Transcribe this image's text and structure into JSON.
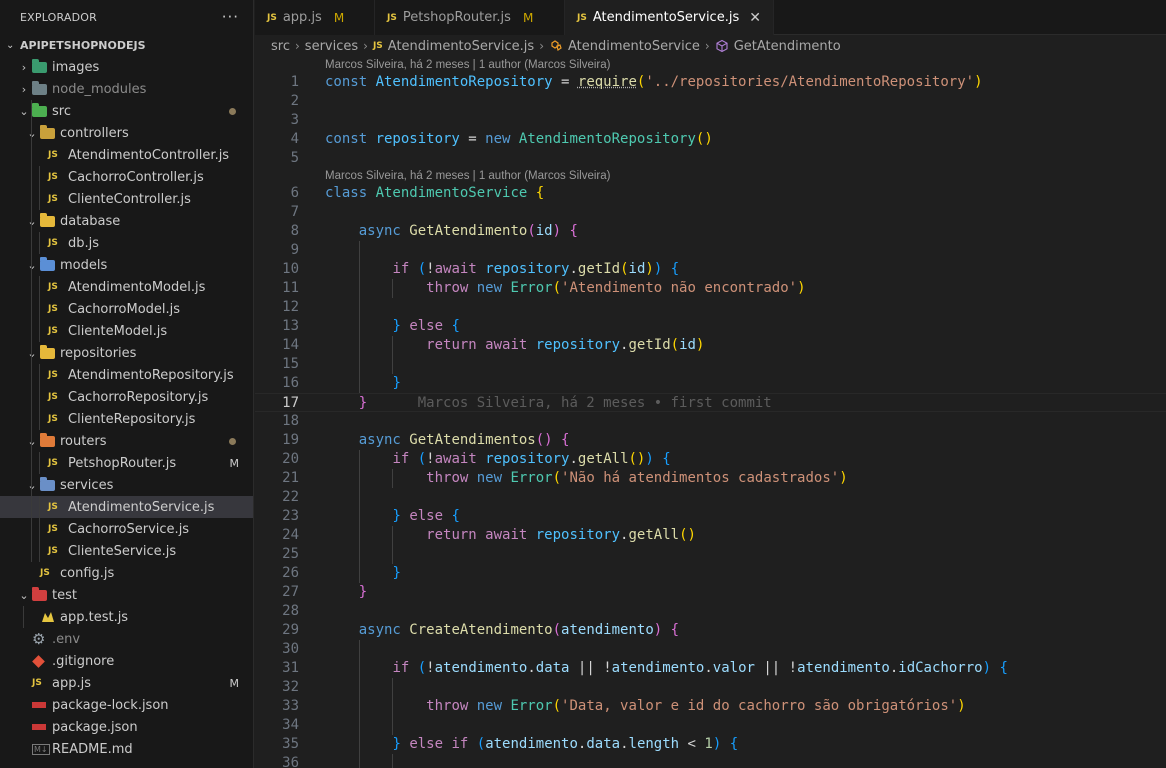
{
  "sidebar": {
    "title": "EXPLORADOR",
    "more": "···",
    "project": "APIPETSHOPNODEJS",
    "items": [
      {
        "label": "images",
        "depth": 1,
        "type": "folder",
        "chev": "›",
        "color": "#3a9b6f"
      },
      {
        "label": "node_modules",
        "depth": 1,
        "type": "folder",
        "chev": "›",
        "color": "#6d8086",
        "dimmed": true
      },
      {
        "label": "src",
        "depth": 1,
        "type": "folder",
        "chev": "⌄",
        "color": "#4caf50",
        "dot": true
      },
      {
        "label": "controllers",
        "depth": 2,
        "type": "folder",
        "chev": "⌄",
        "color": "#c9a13b"
      },
      {
        "label": "AtendimentoController.js",
        "depth": 3,
        "type": "js"
      },
      {
        "label": "CachorroController.js",
        "depth": 3,
        "type": "js"
      },
      {
        "label": "ClienteController.js",
        "depth": 3,
        "type": "js"
      },
      {
        "label": "database",
        "depth": 2,
        "type": "folder",
        "chev": "⌄",
        "color": "#e5b83a"
      },
      {
        "label": "db.js",
        "depth": 3,
        "type": "js"
      },
      {
        "label": "models",
        "depth": 2,
        "type": "folder",
        "chev": "⌄",
        "color": "#5b8fd6"
      },
      {
        "label": "AtendimentoModel.js",
        "depth": 3,
        "type": "js"
      },
      {
        "label": "CachorroModel.js",
        "depth": 3,
        "type": "js"
      },
      {
        "label": "ClienteModel.js",
        "depth": 3,
        "type": "js"
      },
      {
        "label": "repositories",
        "depth": 2,
        "type": "folder",
        "chev": "⌄",
        "color": "#e5b83a"
      },
      {
        "label": "AtendimentoRepository.js",
        "depth": 3,
        "type": "js"
      },
      {
        "label": "CachorroRepository.js",
        "depth": 3,
        "type": "js"
      },
      {
        "label": "ClienteRepository.js",
        "depth": 3,
        "type": "js"
      },
      {
        "label": "routers",
        "depth": 2,
        "type": "folder",
        "chev": "⌄",
        "color": "#e07b39",
        "dot": true
      },
      {
        "label": "PetshopRouter.js",
        "depth": 3,
        "type": "js",
        "status": "M"
      },
      {
        "label": "services",
        "depth": 2,
        "type": "folder",
        "chev": "⌄",
        "color": "#6a8fc7"
      },
      {
        "label": "AtendimentoService.js",
        "depth": 3,
        "type": "js",
        "selected": true
      },
      {
        "label": "CachorroService.js",
        "depth": 3,
        "type": "js"
      },
      {
        "label": "ClienteService.js",
        "depth": 3,
        "type": "js"
      },
      {
        "label": "config.js",
        "depth": 2,
        "type": "js"
      },
      {
        "label": "test",
        "depth": 1,
        "type": "folder",
        "chev": "⌄",
        "color": "#d13f3f"
      },
      {
        "label": "app.test.js",
        "depth": 2,
        "type": "test"
      },
      {
        "label": ".env",
        "depth": 1,
        "type": "env",
        "dimmed": true
      },
      {
        "label": ".gitignore",
        "depth": 1,
        "type": "git"
      },
      {
        "label": "app.js",
        "depth": 1,
        "type": "js",
        "status": "M"
      },
      {
        "label": "package-lock.json",
        "depth": 1,
        "type": "npm"
      },
      {
        "label": "package.json",
        "depth": 1,
        "type": "npm"
      },
      {
        "label": "README.md",
        "depth": 1,
        "type": "md"
      }
    ]
  },
  "tabs": [
    {
      "label": "app.js",
      "status": "M",
      "active": false
    },
    {
      "label": "PetshopRouter.js",
      "status": "M",
      "active": false
    },
    {
      "label": "AtendimentoService.js",
      "status": "",
      "active": true,
      "close": "✕"
    }
  ],
  "breadcrumb": [
    "src",
    "services",
    "AtendimentoService.js",
    "AtendimentoService",
    "GetAtendimento"
  ],
  "editor": {
    "codelens": "Marcos Silveira, há 2 meses | 1 author (Marcos Silveira)",
    "blame": "Marcos Silveira, há 2 meses • first commit",
    "current_line": 17,
    "lines": [
      {
        "n": 1,
        "lens": true,
        "tokens": [
          [
            "kw",
            "const "
          ],
          [
            "var",
            "AtendimentoRepository"
          ],
          [
            "op",
            " = "
          ],
          [
            "req",
            "require"
          ],
          [
            "b1",
            "("
          ],
          [
            "str",
            "'../repositories/AtendimentoRepository'"
          ],
          [
            "b1",
            ")"
          ]
        ]
      },
      {
        "n": 2,
        "tokens": []
      },
      {
        "n": 3,
        "tokens": []
      },
      {
        "n": 4,
        "tokens": [
          [
            "kw",
            "const "
          ],
          [
            "var",
            "repository"
          ],
          [
            "op",
            " = "
          ],
          [
            "kw",
            "new "
          ],
          [
            "cls",
            "AtendimentoRepository"
          ],
          [
            "b1",
            "()"
          ]
        ]
      },
      {
        "n": 5,
        "tokens": []
      },
      {
        "n": 6,
        "lens": true,
        "tokens": [
          [
            "kw",
            "class "
          ],
          [
            "cls",
            "AtendimentoService"
          ],
          [
            "op",
            " "
          ],
          [
            "b1",
            "{"
          ]
        ]
      },
      {
        "n": 7,
        "tokens": []
      },
      {
        "n": 8,
        "tokens": [
          [
            "op",
            "    "
          ],
          [
            "kw",
            "async "
          ],
          [
            "fn",
            "GetAtendimento"
          ],
          [
            "b2",
            "("
          ],
          [
            "prop",
            "id"
          ],
          [
            "b2",
            ")"
          ],
          [
            "op",
            " "
          ],
          [
            "b2",
            "{"
          ]
        ]
      },
      {
        "n": 9,
        "tokens": []
      },
      {
        "n": 10,
        "tokens": [
          [
            "op",
            "        "
          ],
          [
            "ctl",
            "if "
          ],
          [
            "b3",
            "("
          ],
          [
            "op",
            "!"
          ],
          [
            "ctl",
            "await "
          ],
          [
            "var",
            "repository"
          ],
          [
            "op",
            "."
          ],
          [
            "fn",
            "getId"
          ],
          [
            "b1",
            "("
          ],
          [
            "prop",
            "id"
          ],
          [
            "b1",
            ")"
          ],
          [
            "b3",
            ")"
          ],
          [
            "op",
            " "
          ],
          [
            "b3",
            "{"
          ]
        ]
      },
      {
        "n": 11,
        "tokens": [
          [
            "op",
            "            "
          ],
          [
            "ctl",
            "throw "
          ],
          [
            "kw",
            "new "
          ],
          [
            "cls",
            "Error"
          ],
          [
            "b1",
            "("
          ],
          [
            "str",
            "'Atendimento não encontrado'"
          ],
          [
            "b1",
            ")"
          ]
        ]
      },
      {
        "n": 12,
        "tokens": []
      },
      {
        "n": 13,
        "tokens": [
          [
            "op",
            "        "
          ],
          [
            "b3",
            "}"
          ],
          [
            "op",
            " "
          ],
          [
            "ctl",
            "else "
          ],
          [
            "b3",
            "{"
          ]
        ]
      },
      {
        "n": 14,
        "tokens": [
          [
            "op",
            "            "
          ],
          [
            "ctl",
            "return "
          ],
          [
            "ctl",
            "await "
          ],
          [
            "var",
            "repository"
          ],
          [
            "op",
            "."
          ],
          [
            "fn",
            "getId"
          ],
          [
            "b1",
            "("
          ],
          [
            "prop",
            "id"
          ],
          [
            "b1",
            ")"
          ]
        ]
      },
      {
        "n": 15,
        "tokens": []
      },
      {
        "n": 16,
        "tokens": [
          [
            "op",
            "        "
          ],
          [
            "b3",
            "}"
          ]
        ]
      },
      {
        "n": 17,
        "tokens": [
          [
            "op",
            "    "
          ],
          [
            "b2",
            "}"
          ]
        ],
        "blame": true
      },
      {
        "n": 18,
        "tokens": []
      },
      {
        "n": 19,
        "tokens": [
          [
            "op",
            "    "
          ],
          [
            "kw",
            "async "
          ],
          [
            "fn",
            "GetAtendimentos"
          ],
          [
            "b2",
            "()"
          ],
          [
            "op",
            " "
          ],
          [
            "b2",
            "{"
          ]
        ]
      },
      {
        "n": 20,
        "tokens": [
          [
            "op",
            "        "
          ],
          [
            "ctl",
            "if "
          ],
          [
            "b3",
            "("
          ],
          [
            "op",
            "!"
          ],
          [
            "ctl",
            "await "
          ],
          [
            "var",
            "repository"
          ],
          [
            "op",
            "."
          ],
          [
            "fn",
            "getAll"
          ],
          [
            "b1",
            "()"
          ],
          [
            "b3",
            ")"
          ],
          [
            "op",
            " "
          ],
          [
            "b3",
            "{"
          ]
        ]
      },
      {
        "n": 21,
        "tokens": [
          [
            "op",
            "            "
          ],
          [
            "ctl",
            "throw "
          ],
          [
            "kw",
            "new "
          ],
          [
            "cls",
            "Error"
          ],
          [
            "b1",
            "("
          ],
          [
            "str",
            "'Não há atendimentos cadastrados'"
          ],
          [
            "b1",
            ")"
          ]
        ]
      },
      {
        "n": 22,
        "tokens": []
      },
      {
        "n": 23,
        "tokens": [
          [
            "op",
            "        "
          ],
          [
            "b3",
            "}"
          ],
          [
            "op",
            " "
          ],
          [
            "ctl",
            "else "
          ],
          [
            "b3",
            "{"
          ]
        ]
      },
      {
        "n": 24,
        "tokens": [
          [
            "op",
            "            "
          ],
          [
            "ctl",
            "return "
          ],
          [
            "ctl",
            "await "
          ],
          [
            "var",
            "repository"
          ],
          [
            "op",
            "."
          ],
          [
            "fn",
            "getAll"
          ],
          [
            "b1",
            "()"
          ]
        ]
      },
      {
        "n": 25,
        "tokens": []
      },
      {
        "n": 26,
        "tokens": [
          [
            "op",
            "        "
          ],
          [
            "b3",
            "}"
          ]
        ]
      },
      {
        "n": 27,
        "tokens": [
          [
            "op",
            "    "
          ],
          [
            "b2",
            "}"
          ]
        ]
      },
      {
        "n": 28,
        "tokens": []
      },
      {
        "n": 29,
        "tokens": [
          [
            "op",
            "    "
          ],
          [
            "kw",
            "async "
          ],
          [
            "fn",
            "CreateAtendimento"
          ],
          [
            "b2",
            "("
          ],
          [
            "prop",
            "atendimento"
          ],
          [
            "b2",
            ")"
          ],
          [
            "op",
            " "
          ],
          [
            "b2",
            "{"
          ]
        ]
      },
      {
        "n": 30,
        "tokens": []
      },
      {
        "n": 31,
        "tokens": [
          [
            "op",
            "        "
          ],
          [
            "ctl",
            "if "
          ],
          [
            "b3",
            "("
          ],
          [
            "op",
            "!"
          ],
          [
            "prop",
            "atendimento"
          ],
          [
            "op",
            "."
          ],
          [
            "prop",
            "data"
          ],
          [
            "op",
            " || !"
          ],
          [
            "prop",
            "atendimento"
          ],
          [
            "op",
            "."
          ],
          [
            "prop",
            "valor"
          ],
          [
            "op",
            " || !"
          ],
          [
            "prop",
            "atendimento"
          ],
          [
            "op",
            "."
          ],
          [
            "prop",
            "idCachorro"
          ],
          [
            "b3",
            ")"
          ],
          [
            "op",
            " "
          ],
          [
            "b3",
            "{"
          ]
        ]
      },
      {
        "n": 32,
        "tokens": []
      },
      {
        "n": 33,
        "tokens": [
          [
            "op",
            "            "
          ],
          [
            "ctl",
            "throw "
          ],
          [
            "kw",
            "new "
          ],
          [
            "cls",
            "Error"
          ],
          [
            "b1",
            "("
          ],
          [
            "str",
            "'Data, valor e id do cachorro são obrigatórios'"
          ],
          [
            "b1",
            ")"
          ]
        ]
      },
      {
        "n": 34,
        "tokens": []
      },
      {
        "n": 35,
        "tokens": [
          [
            "op",
            "        "
          ],
          [
            "b3",
            "}"
          ],
          [
            "op",
            " "
          ],
          [
            "ctl",
            "else "
          ],
          [
            "ctl",
            "if "
          ],
          [
            "b3",
            "("
          ],
          [
            "prop",
            "atendimento"
          ],
          [
            "op",
            "."
          ],
          [
            "prop",
            "data"
          ],
          [
            "op",
            "."
          ],
          [
            "prop",
            "length"
          ],
          [
            "op",
            " < "
          ],
          [
            "num",
            "1"
          ],
          [
            "b3",
            ")"
          ],
          [
            "op",
            " "
          ],
          [
            "b3",
            "{"
          ]
        ]
      },
      {
        "n": 36,
        "tokens": []
      }
    ]
  }
}
